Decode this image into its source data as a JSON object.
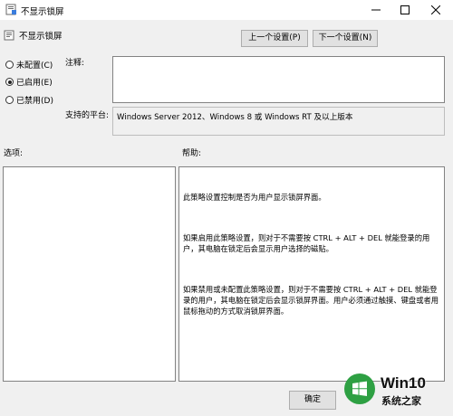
{
  "window": {
    "title": "不显示锁屏"
  },
  "header": {
    "title": "不显示锁屏",
    "prev_button": "上一个设置(P)",
    "next_button": "下一个设置(N)"
  },
  "state_options": [
    {
      "label": "未配置(C)",
      "selected": false
    },
    {
      "label": "已启用(E)",
      "selected": true
    },
    {
      "label": "已禁用(D)",
      "selected": false
    }
  ],
  "comment": {
    "label": "注释:",
    "value": ""
  },
  "supported": {
    "label": "支持的平台:",
    "value": "Windows Server 2012、Windows 8 或 Windows RT 及以上版本"
  },
  "options_pane": {
    "label": "选项:"
  },
  "help_pane": {
    "label": "帮助:",
    "paragraphs": [
      "此策略设置控制是否为用户显示锁屏界面。",
      "如果启用此策略设置，则对于不需要按 CTRL + ALT + DEL 就能登录的用户，其电脑在锁定后会显示用户选择的磁贴。",
      "如果禁用或未配置此策略设置，则对于不需要按 CTRL + ALT + DEL 就能登录的用户，其电脑在锁定后会显示锁屏界面。用户必须通过触摸、键盘或者用鼠标拖动的方式取消锁屏界面。"
    ]
  },
  "footer": {
    "ok_button": "确定"
  },
  "watermark": {
    "brand": "Win10",
    "site": "系统之家"
  }
}
